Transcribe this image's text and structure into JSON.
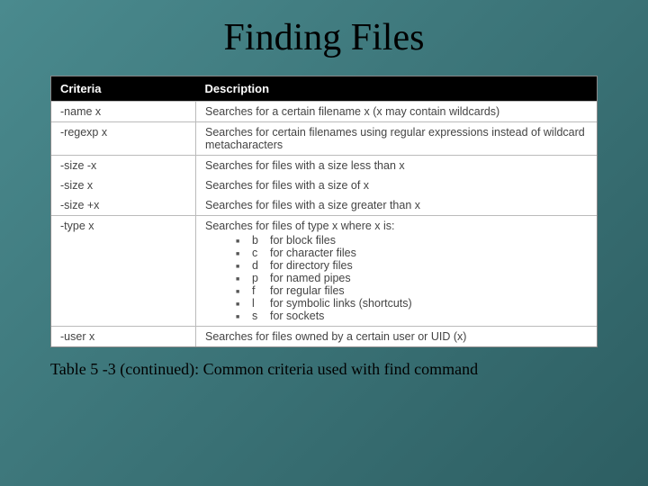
{
  "title": "Finding Files",
  "table": {
    "headers": {
      "criteria": "Criteria",
      "description": "Description"
    },
    "rows": {
      "name": {
        "criteria": "-name x",
        "desc": "Searches for a certain filename x (x may contain wildcards)"
      },
      "regexp": {
        "criteria": "-regexp x",
        "desc": "Searches for certain filenames using regular expressions instead of wildcard metacharacters"
      },
      "sizeminus": {
        "criteria": "-size -x",
        "desc": "Searches for files with a size less than x"
      },
      "sizeeq": {
        "criteria": "-size x",
        "desc": "Searches for files with a size of x"
      },
      "sizeplus": {
        "criteria": "-size +x",
        "desc": "Searches for files with a size greater than x"
      },
      "type": {
        "criteria": "-type x",
        "desc": "Searches for files of type x where x is:",
        "options": {
          "b": {
            "code": "b",
            "text": "for block files"
          },
          "c": {
            "code": "c",
            "text": "for character files"
          },
          "d": {
            "code": "d",
            "text": "for directory files"
          },
          "p": {
            "code": "p",
            "text": "for named pipes"
          },
          "f": {
            "code": "f",
            "text": "for regular files"
          },
          "l": {
            "code": "l",
            "text": "for symbolic links (shortcuts)"
          },
          "s": {
            "code": "s",
            "text": "for sockets"
          }
        }
      },
      "user": {
        "criteria": "-user x",
        "desc": "Searches for files owned by a certain user or UID (x)"
      }
    }
  },
  "caption": "Table 5 -3 (continued): Common criteria used with find command"
}
